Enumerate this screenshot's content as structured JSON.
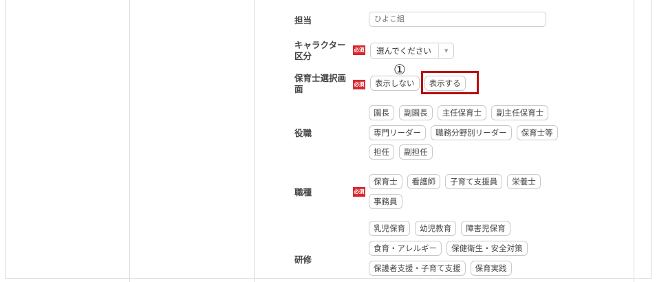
{
  "form": {
    "tantou": {
      "label": "担当",
      "placeholder": "ひよこ組"
    },
    "character": {
      "label_line1": "キャラクター",
      "label_line2": "区分",
      "required": "必須",
      "select_value": "選んでください",
      "arrow": "▼"
    },
    "screen": {
      "label_line1": "保育士選択画",
      "label_line2": "面",
      "required": "必須",
      "options": [
        "表示しない",
        "表示する"
      ]
    },
    "position": {
      "label": "役職",
      "tags_row1": [
        "園長",
        "副園長",
        "主任保育士",
        "副主任保育士"
      ],
      "tags_row2": [
        "専門リーダー",
        "職務分野別リーダー",
        "保育士等"
      ],
      "tags_row3": [
        "担任",
        "副担任"
      ]
    },
    "occupation": {
      "label": "職種",
      "required": "必須",
      "tags_row1": [
        "保育士",
        "看護師",
        "子育て支援員",
        "栄養士"
      ],
      "tags_row2": [
        "事務員"
      ]
    },
    "training": {
      "label": "研修",
      "tags_row1": [
        "乳児保育",
        "幼児教育",
        "障害児保育"
      ],
      "tags_row2": [
        "食育・アレルギー",
        "保健衛生・安全対策"
      ],
      "tags_row3": [
        "保護者支援・子育て支援",
        "保育実践"
      ]
    }
  },
  "annotation": {
    "marker": "①"
  },
  "colors": {
    "required_badge": "#d7262e",
    "highlight_box": "#b80f0f"
  }
}
